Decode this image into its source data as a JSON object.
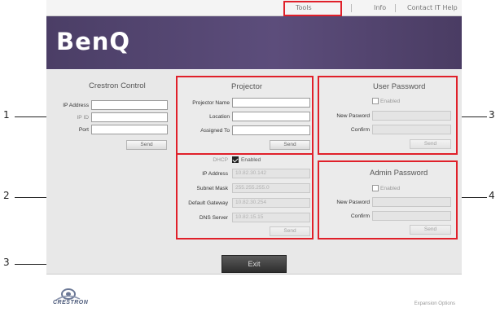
{
  "nav": {
    "tools": "Tools",
    "info": "Info",
    "help": "Contact IT Help"
  },
  "brand": {
    "logo": "BenQ"
  },
  "crestron_control": {
    "title": "Crestron Control",
    "ip_address_label": "IP Address",
    "ip_id_label": "IP ID",
    "port_label": "Port",
    "send": "Send"
  },
  "projector": {
    "title": "Projector",
    "name_label": "Projector Name",
    "location_label": "Location",
    "assigned_label": "Assigned To",
    "send": "Send"
  },
  "network": {
    "dhcp_label": "DHCP",
    "dhcp_checkbox": "Enabled",
    "dhcp_checked": true,
    "ip_label": "IP Address",
    "ip_value": "10.82.30.142",
    "subnet_label": "Subnet Mask",
    "subnet_value": "255.255.255.0",
    "gateway_label": "Default Gateway",
    "gateway_value": "10.82.30.254",
    "dns_label": "DNS Server",
    "dns_value": "10.82.15.15",
    "send": "Send"
  },
  "user_password": {
    "title": "User Password",
    "enabled_label": "Enabled",
    "new_label": "New Pasword",
    "confirm_label": "Confirm",
    "send": "Send"
  },
  "admin_password": {
    "title": "Admin Password",
    "enabled_label": "Enabled",
    "new_label": "New Pasword",
    "confirm_label": "Confirm",
    "send": "Send"
  },
  "exit": "Exit",
  "footer": {
    "crestron": "CRESTRON",
    "expansion": "Expansion Options"
  },
  "callouts": {
    "c1": "1",
    "c2": "2",
    "c3a": "3",
    "c3b": "3",
    "c4": "4"
  },
  "colors": {
    "highlight": "#e0202a",
    "header": "#5c4d7b"
  }
}
